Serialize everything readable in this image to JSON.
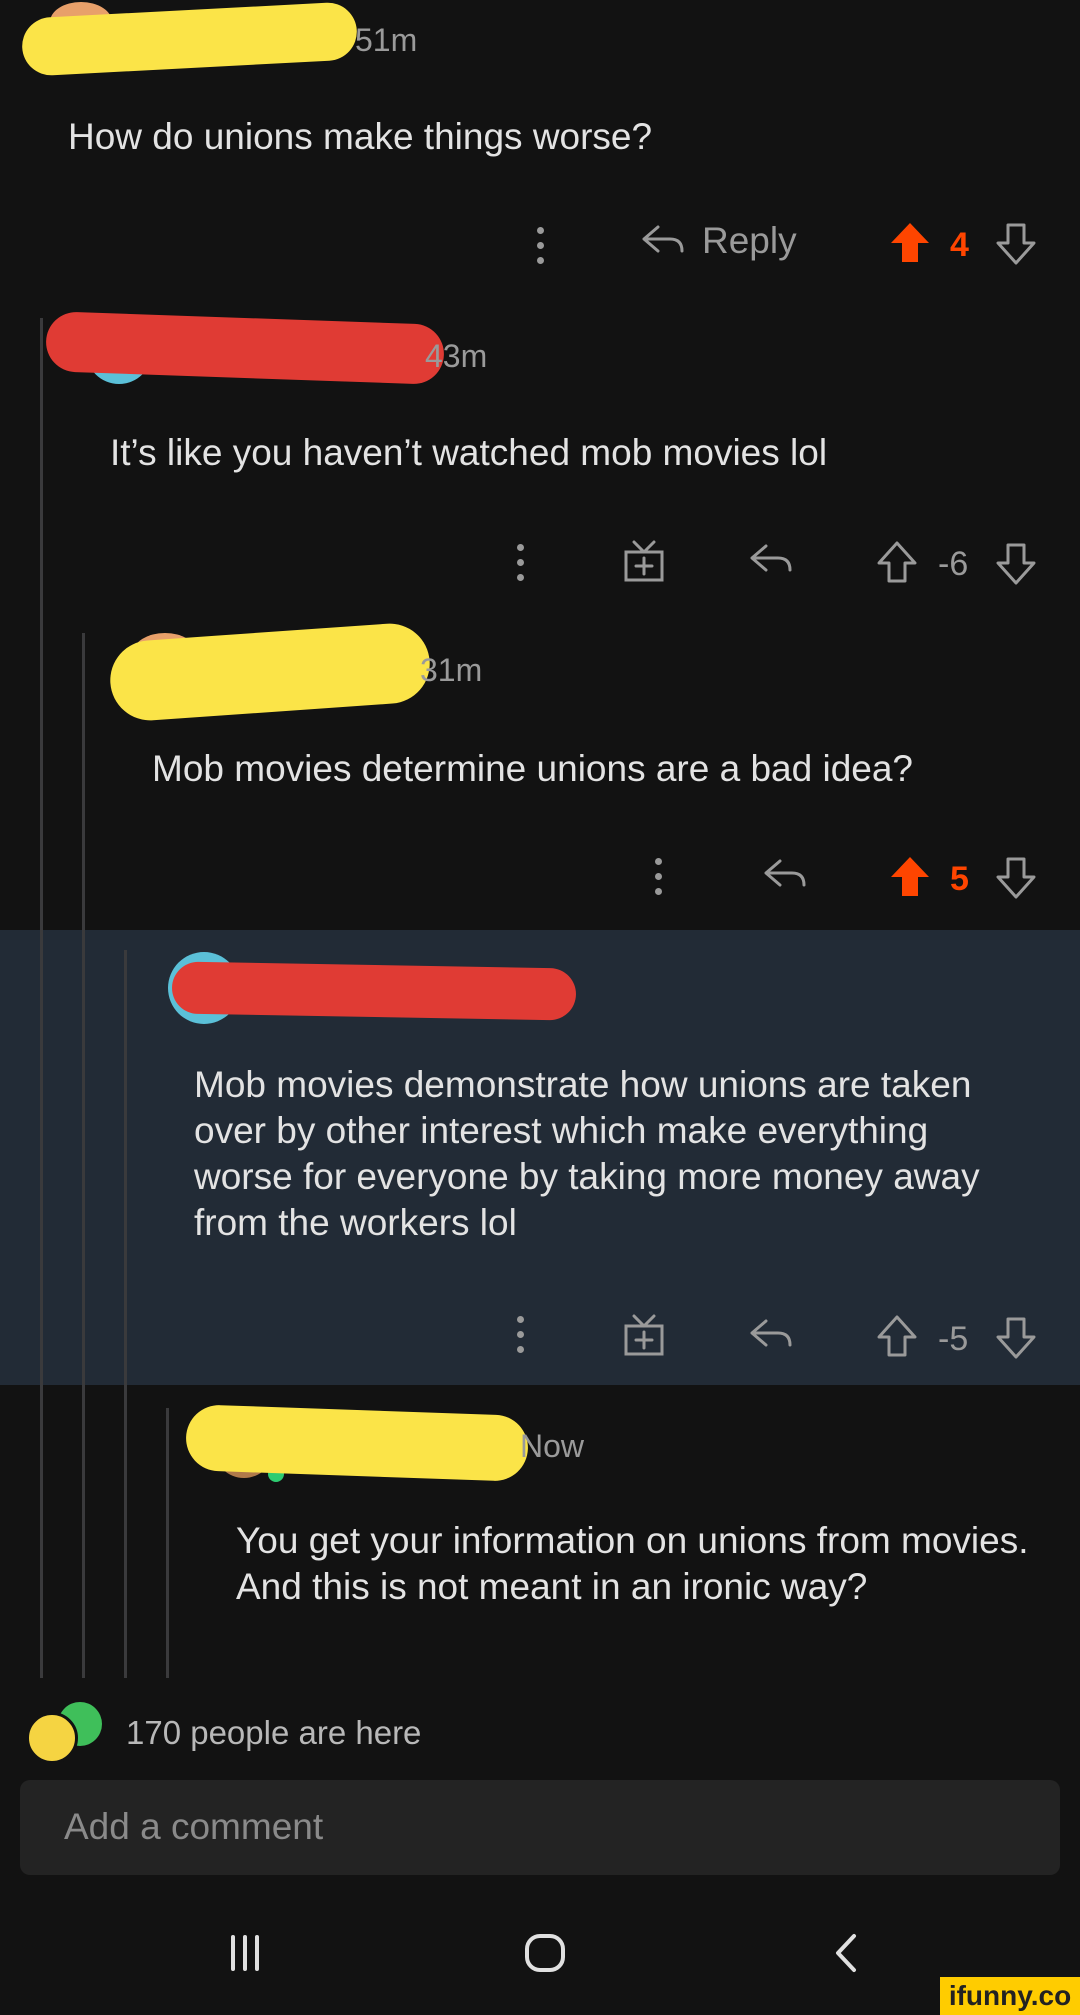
{
  "comments": [
    {
      "time": "51m",
      "body": "How do unions make things worse?",
      "reply_label": "Reply",
      "score": "4",
      "vote": "up"
    },
    {
      "time": "43m",
      "body": "It’s like you haven’t watched mob movies lol",
      "score": "-6",
      "vote": "none"
    },
    {
      "time": "31m",
      "body": "Mob movies determine unions are a bad idea?",
      "score": "5",
      "vote": "up"
    },
    {
      "time": "",
      "body": "Mob movies demonstrate how unions are taken over by other interest which make everything worse for everyone by taking more money away from the workers lol",
      "score": "-5",
      "vote": "none"
    },
    {
      "time": "Now",
      "body": "You get your information on unions from movies. And this is not meant in an ironic way?"
    }
  ],
  "presence": {
    "text": "170 people are here"
  },
  "composer": {
    "placeholder": "Add a comment"
  },
  "watermark": {
    "text": "ifunny.co"
  },
  "colors": {
    "background": "#121212",
    "highlight": "#222b36",
    "upvote": "#ff4500",
    "redaction_yellow": "#fbe448",
    "redaction_red": "#e03b34"
  }
}
